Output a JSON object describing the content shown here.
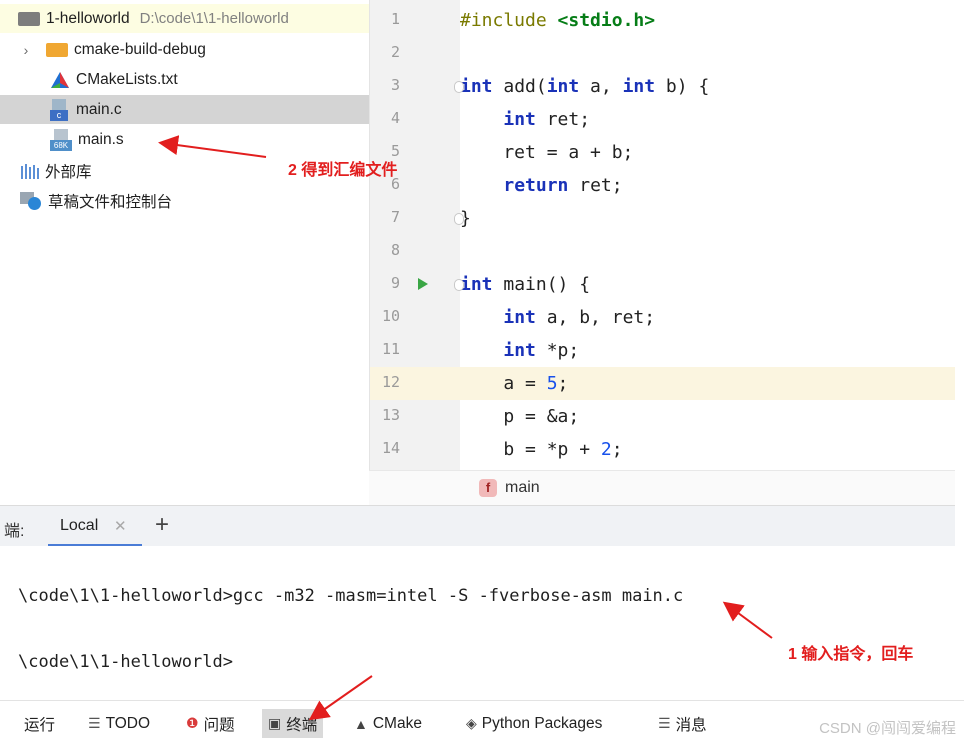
{
  "project_tree": {
    "root": {
      "name": "1-helloworld",
      "path": "D:\\code\\1\\1-helloworld"
    },
    "items": [
      {
        "label": "cmake-build-debug",
        "icon": "folder-icon",
        "color": "#f0a732"
      },
      {
        "label": "CMakeLists.txt",
        "icon": "cmake-icon"
      },
      {
        "label": "main.c",
        "icon": "c-file-icon",
        "icon_text": "c"
      },
      {
        "label": "main.s",
        "icon": "asm-file-icon",
        "icon_text": "68K"
      }
    ],
    "external_libraries": "外部库",
    "scratches": "草稿文件和控制台"
  },
  "editor": {
    "line_numbers": [
      "1",
      "2",
      "3",
      "4",
      "5",
      "6",
      "7",
      "8",
      "9",
      "10",
      "11",
      "12",
      "13",
      "14"
    ],
    "current_line": "12",
    "breadcrumb_badge": "f",
    "breadcrumb": "main"
  },
  "code_lines": [
    [
      {
        "t": "#include ",
        "c": "pp"
      },
      {
        "t": "<stdio.h>",
        "c": "hdr"
      }
    ],
    [],
    [
      {
        "t": "int",
        "c": "kw"
      },
      {
        "t": " add("
      },
      {
        "t": "int",
        "c": "kw"
      },
      {
        "t": " a, "
      },
      {
        "t": "int",
        "c": "kw"
      },
      {
        "t": " b) {"
      }
    ],
    [
      {
        "t": "    "
      },
      {
        "t": "int",
        "c": "kw"
      },
      {
        "t": " ret;"
      }
    ],
    [
      {
        "t": "    ret = a + b;"
      }
    ],
    [
      {
        "t": "    "
      },
      {
        "t": "return",
        "c": "kw"
      },
      {
        "t": " ret;"
      }
    ],
    [
      {
        "t": "}"
      }
    ],
    [],
    [
      {
        "t": "int",
        "c": "kw"
      },
      {
        "t": " main() {"
      }
    ],
    [
      {
        "t": "    "
      },
      {
        "t": "int",
        "c": "kw"
      },
      {
        "t": " a, b, ret;"
      }
    ],
    [
      {
        "t": "    "
      },
      {
        "t": "int",
        "c": "kw"
      },
      {
        "t": " *p;"
      }
    ],
    [
      {
        "t": "    a = "
      },
      {
        "t": "5",
        "c": "num"
      },
      {
        "t": ";"
      }
    ],
    [
      {
        "t": "    p = &a;"
      }
    ],
    [
      {
        "t": "    b = *p + "
      },
      {
        "t": "2",
        "c": "num"
      },
      {
        "t": ";"
      }
    ]
  ],
  "terminal": {
    "label": "端:",
    "tab": "Local",
    "lines": [
      "\\code\\1\\1-helloworld>gcc -m32 -masm=intel -S -fverbose-asm main.c",
      "\\code\\1\\1-helloworld>"
    ]
  },
  "toolbar": {
    "items": [
      {
        "label": "运行",
        "icon": ""
      },
      {
        "label": "TODO",
        "icon": "☰"
      },
      {
        "label": "问题",
        "icon": "❶"
      },
      {
        "label": "终端",
        "icon": "▣"
      },
      {
        "label": "CMake",
        "icon": "▲"
      },
      {
        "label": "Python Packages",
        "icon": "◈"
      },
      {
        "label": "消息",
        "icon": "☰"
      }
    ],
    "active": "终端"
  },
  "watermark": "CSDN @闯闯爱编程",
  "annotations": {
    "asm_file": "2 得到汇编文件",
    "enter_command": "1 输入指令，回车"
  },
  "colors": {
    "annotation_red": "#e21e1e",
    "keyword": "#1a32b8",
    "header_green": "#067d17",
    "number": "#1750eb",
    "current_line": "#fbf5e0"
  }
}
